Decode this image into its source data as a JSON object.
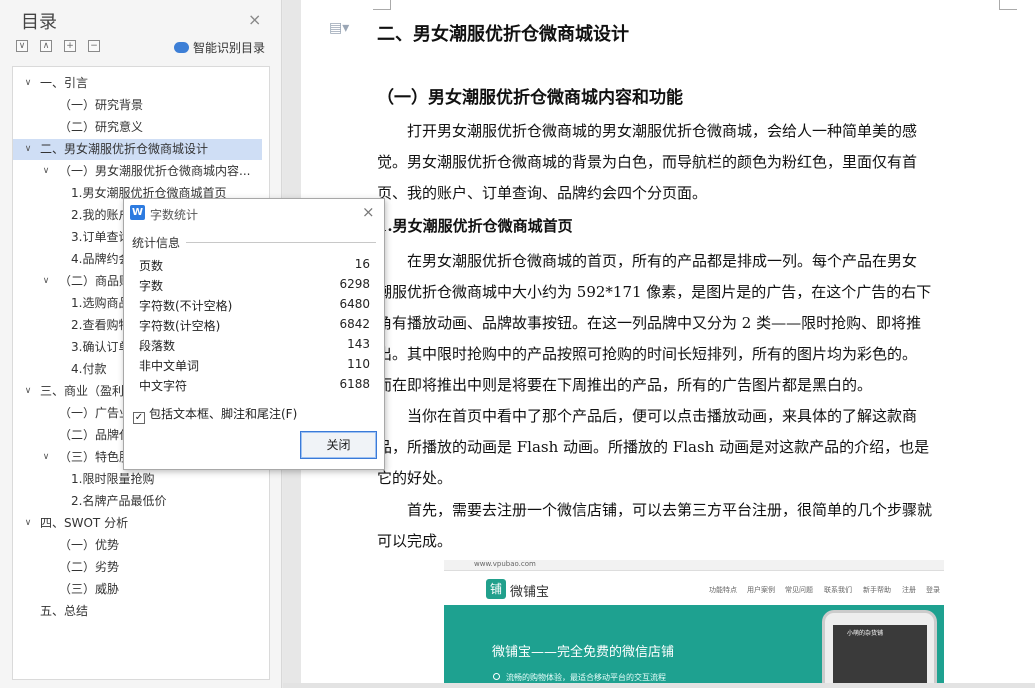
{
  "toc": {
    "title": "目录",
    "close_icon": "×",
    "tool_icons": [
      "∨",
      "∧",
      "+",
      "−"
    ],
    "smart_label": "智能识别目录",
    "items": [
      {
        "label": "一、引言",
        "arrow": "∨"
      },
      {
        "label": "（一）研究背景",
        "arrow": ""
      },
      {
        "label": "（二）研究意义",
        "arrow": ""
      },
      {
        "label": "二、男女潮服优折仓微商城设计",
        "arrow": "∨",
        "selected": true
      },
      {
        "label": "（一）男女潮服优折仓微商城内容...",
        "arrow": "∨"
      },
      {
        "label": "1.男女潮服优折仓微商城首页",
        "arrow": ""
      },
      {
        "label": "2.我的账户",
        "arrow": ""
      },
      {
        "label": "3.订单查询",
        "arrow": ""
      },
      {
        "label": "4.品牌约会",
        "arrow": ""
      },
      {
        "label": "（二）商品购",
        "arrow": "∨"
      },
      {
        "label": "1.选购商品",
        "arrow": ""
      },
      {
        "label": "2.查看购物",
        "arrow": ""
      },
      {
        "label": "3.确认订单",
        "arrow": ""
      },
      {
        "label": "4.付款",
        "arrow": ""
      },
      {
        "label": "三、商业（盈利",
        "arrow": "∨"
      },
      {
        "label": "（一）广告业",
        "arrow": ""
      },
      {
        "label": "（二）品牌代",
        "arrow": ""
      },
      {
        "label": "（三）特色服",
        "arrow": "∨"
      },
      {
        "label": "1.限时限量抢购",
        "arrow": ""
      },
      {
        "label": "2.名牌产品最低价",
        "arrow": ""
      },
      {
        "label": "四、SWOT 分析",
        "arrow": "∨"
      },
      {
        "label": "（一）优势",
        "arrow": ""
      },
      {
        "label": "（二）劣势",
        "arrow": ""
      },
      {
        "label": "（三）威胁",
        "arrow": ""
      },
      {
        "label": "五、总结",
        "arrow": ""
      }
    ]
  },
  "dialog": {
    "title": "字数统计",
    "app_icon": "W",
    "close_icon": "×",
    "group_label": "统计信息",
    "stats": [
      {
        "label": "页数",
        "value": "16"
      },
      {
        "label": "字数",
        "value": "6298"
      },
      {
        "label": "字符数(不计空格)",
        "value": "6480"
      },
      {
        "label": "字符数(计空格)",
        "value": "6842"
      },
      {
        "label": "段落数",
        "value": "143"
      },
      {
        "label": "非中文单词",
        "value": "110"
      },
      {
        "label": "中文字符",
        "value": "6188"
      }
    ],
    "checkbox_label": "包括文本框、脚注和尾注(F)",
    "checkbox_checked": true,
    "checkbox_mark": "✓",
    "close_button": "关闭"
  },
  "document": {
    "nav_icon": "▤▾",
    "lines": [
      {
        "style": "h1",
        "text": "二、男女潮服优折仓微商城设计"
      },
      {
        "style": "h2",
        "text": "（一）男女潮服优折仓微商城内容和功能"
      },
      {
        "style": "p",
        "text": "打开男女潮服优折仓微商城的男女潮服优折仓微商城，会给人一种简单美的感"
      },
      {
        "style": "p",
        "text": "觉。男女潮服优折仓微商城的背景为白色，而导航栏的颜色为粉红色，里面仅有首"
      },
      {
        "style": "p",
        "text": "页、我的账户、订单查询、品牌约会四个分页面。"
      },
      {
        "style": "h3",
        "text": "1.男女潮服优折仓微商城首页"
      },
      {
        "style": "p",
        "text": "在男女潮服优折仓微商城的首页，所有的产品都是排成一列。每个产品在男女"
      },
      {
        "style": "p",
        "text": "潮服优折仓微商城中大小约为 592*171 像素，是图片是的广告，在这个广告的右下"
      },
      {
        "style": "p",
        "text": "角有播放动画、品牌故事按钮。在这一列品牌中又分为 2 类——限时抢购、即将推"
      },
      {
        "style": "p",
        "text": "出。其中限时抢购中的产品按照可抢购的时间长短排列，所有的图片均为彩色的。"
      },
      {
        "style": "p",
        "text": "而在即将推出中则是将要在下周推出的产品，所有的广告图片都是黑白的。"
      },
      {
        "style": "p",
        "text": "当你在首页中看中了那个产品后，便可以点击播放动画，来具体的了解这款商"
      },
      {
        "style": "p",
        "text": "品，所播放的动画是 Flash 动画。所播放的 Flash 动画是对这款产品的介绍，也是"
      },
      {
        "style": "p",
        "text": "它的好处。"
      },
      {
        "style": "p",
        "text": "首先，需要去注册一个微信店铺，可以去第三方平台注册，很简单的几个步骤就"
      },
      {
        "style": "p",
        "text": "可以完成。"
      }
    ],
    "embed": {
      "url": "www.vpubao.com",
      "logo_mark": "铺",
      "logo_text": "微铺宝",
      "nav_links": [
        "功能特点",
        "用户案例",
        "常见问题",
        "联系我们",
        "新手帮助",
        "注册",
        "登录"
      ],
      "hero_title": "微铺宝——完全免费的微信店铺",
      "hero_sub": "流畅的购物体验，最适合移动平台的交互流程",
      "phone_text": "小萌的杂货铺"
    }
  },
  "colors": {
    "toc_selected": "#cfdef5",
    "dialog_button_border": "#3b7ad8",
    "embed_brand": "#1ea190"
  }
}
